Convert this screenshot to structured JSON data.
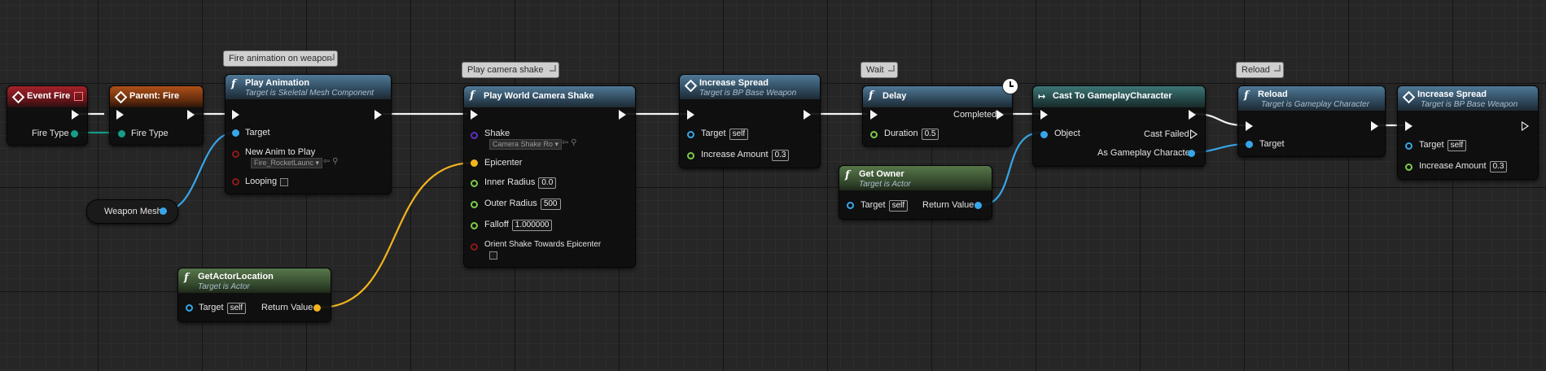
{
  "comments": {
    "fire_anim": "Fire animation on weapon",
    "camera_shake": "Play camera shake",
    "wait": "Wait",
    "reload": "Reload"
  },
  "nodes": {
    "event_fire": {
      "title": "Event Fire",
      "pin_fire_type": "Fire Type"
    },
    "parent_fire": {
      "title": "Parent: Fire",
      "pin_fire_type": "Fire Type"
    },
    "play_animation": {
      "title": "Play Animation",
      "subtitle": "Target is Skeletal Mesh Component",
      "pin_target": "Target",
      "pin_new_anim": "New Anim to Play",
      "anim_value": "Fire_RocketLaunc",
      "pin_looping": "Looping"
    },
    "weapon_mesh": {
      "title": "Weapon Mesh"
    },
    "camera_shake": {
      "title": "Play World Camera Shake",
      "pin_shake": "Shake",
      "shake_value": "Camera Shake Ro",
      "pin_epicenter": "Epicenter",
      "pin_inner": "Inner Radius",
      "inner_value": "0.0",
      "pin_outer": "Outer Radius",
      "outer_value": "500",
      "pin_falloff": "Falloff",
      "falloff_value": "1.000000",
      "pin_orient": "Orient Shake Towards Epicenter"
    },
    "get_actor_location": {
      "title": "GetActorLocation",
      "subtitle": "Target is Actor",
      "pin_target": "Target",
      "target_value": "self",
      "pin_return": "Return Value"
    },
    "increase_spread_1": {
      "title": "Increase Spread",
      "subtitle": "Target is BP Base Weapon",
      "pin_target": "Target",
      "target_value": "self",
      "pin_amount": "Increase Amount",
      "amount_value": "0.3"
    },
    "delay": {
      "title": "Delay",
      "pin_completed": "Completed",
      "pin_duration": "Duration",
      "duration_value": "0.5"
    },
    "get_owner": {
      "title": "Get Owner",
      "subtitle": "Target is Actor",
      "pin_target": "Target",
      "target_value": "self",
      "pin_return": "Return Value"
    },
    "cast": {
      "title": "Cast To GameplayCharacter",
      "pin_object": "Object",
      "pin_cast_failed": "Cast Failed",
      "pin_as": "As Gameplay Character"
    },
    "reload": {
      "title": "Reload",
      "subtitle": "Target is Gameplay Character",
      "pin_target": "Target"
    },
    "increase_spread_2": {
      "title": "Increase Spread",
      "subtitle": "Target is BP Base Weapon",
      "pin_target": "Target",
      "target_value": "self",
      "pin_amount": "Increase Amount",
      "amount_value": "0.3"
    }
  },
  "colors": {
    "exec": "#f4f4f4",
    "object": "#37a6e8",
    "float": "#7ccb4b",
    "vector": "#f2b41f",
    "enum": "#169c8a",
    "bool": "#8b1a1a",
    "class": "#5e2fc5"
  }
}
